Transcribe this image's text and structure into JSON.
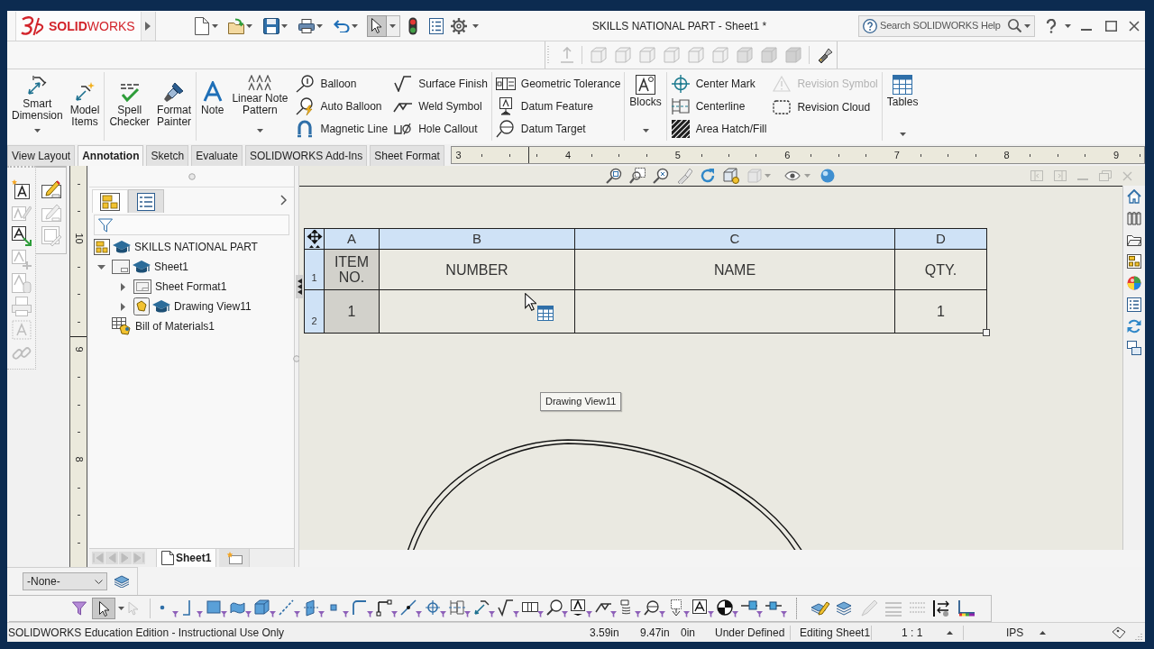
{
  "window": {
    "logo": "**SOLID**WORKS",
    "title": "SKILLS NATIONAL PART - Sheet1 *"
  },
  "quick_access": {
    "pointer_pressed": true
  },
  "search": {
    "placeholder": "Search SOLIDWORKS Help"
  },
  "ribbon": {
    "groups": [
      {
        "items": [
          {
            "kind": "large",
            "label": "Smart Dimension",
            "menu": true
          },
          {
            "kind": "large",
            "label": "Model Items",
            "menu": false
          }
        ]
      },
      {
        "items": [
          {
            "kind": "large",
            "label": "Spell Checker",
            "menu": false
          },
          {
            "kind": "large",
            "label": "Format Painter",
            "menu": false
          }
        ]
      },
      {
        "items": [
          {
            "kind": "large",
            "label": "Note",
            "menu": false
          },
          {
            "kind": "large",
            "label": "Linear Note Pattern",
            "menu": true
          },
          {
            "kind": "stack",
            "entries": [
              {
                "label": "Balloon",
                "disabled": false
              },
              {
                "label": "Auto Balloon",
                "disabled": false
              },
              {
                "label": "Magnetic Line",
                "disabled": false
              }
            ]
          },
          {
            "kind": "stack",
            "entries": [
              {
                "label": "Surface Finish",
                "disabled": false
              },
              {
                "label": "Weld Symbol",
                "disabled": false
              },
              {
                "label": "Hole Callout",
                "disabled": false
              }
            ]
          }
        ]
      },
      {
        "items": [
          {
            "kind": "stack",
            "entries": [
              {
                "label": "Geometric Tolerance",
                "disabled": false
              },
              {
                "label": "Datum Feature",
                "disabled": false
              },
              {
                "label": "Datum Target",
                "disabled": false
              }
            ]
          }
        ]
      },
      {
        "items": [
          {
            "kind": "large",
            "label": "Blocks",
            "menu": true
          }
        ]
      },
      {
        "items": [
          {
            "kind": "stack",
            "entries": [
              {
                "label": "Center Mark",
                "disabled": false
              },
              {
                "label": "Centerline",
                "disabled": false
              },
              {
                "label": "Area Hatch/Fill",
                "disabled": false
              }
            ]
          },
          {
            "kind": "stack",
            "entries": [
              {
                "label": "Revision Symbol",
                "disabled": true
              },
              {
                "label": "Revision Cloud",
                "disabled": false
              }
            ]
          }
        ]
      },
      {
        "items": [
          {
            "kind": "large",
            "label": "Tables",
            "menu": true
          }
        ]
      }
    ]
  },
  "tabs": [
    {
      "label": "View Layout",
      "selected": false
    },
    {
      "label": "Annotation",
      "selected": true
    },
    {
      "label": "Sketch",
      "selected": false
    },
    {
      "label": "Evaluate",
      "selected": false
    },
    {
      "label": "SOLIDWORKS Add-Ins",
      "selected": false
    },
    {
      "label": "Sheet Format",
      "selected": false
    }
  ],
  "top_ruler": {
    "labels": [
      "3",
      "4",
      "5",
      "6",
      "7",
      "8",
      "9"
    ]
  },
  "side_ruler": {
    "labels": [
      "10",
      "9",
      "8"
    ]
  },
  "feature_manager": {
    "tabs": [
      {
        "selected": true
      },
      {
        "selected": false
      }
    ],
    "tree": [
      {
        "label": "SKILLS NATIONAL PART",
        "kind": "drawing",
        "children": [
          {
            "label": "Sheet1",
            "kind": "sheet",
            "expanded": true,
            "children": [
              {
                "label": "Sheet Format1",
                "kind": "sheet_format",
                "expanded": false
              },
              {
                "label": "Drawing View11",
                "kind": "view",
                "expanded": false
              }
            ]
          },
          {
            "label": "Bill of Materials1",
            "kind": "bom"
          }
        ]
      }
    ],
    "sheet_tab": "Sheet1"
  },
  "bom_table": {
    "columns": [
      {
        "letter": "A",
        "locked": true
      },
      {
        "letter": "B",
        "locked": false
      },
      {
        "letter": "C",
        "locked": false
      },
      {
        "letter": "D",
        "locked": false
      }
    ],
    "rows": [
      {
        "number": "1",
        "cells": [
          "ITEM NO.",
          "NUMBER",
          "NAME",
          "QTY."
        ]
      },
      {
        "number": "2",
        "cells": [
          "1",
          null,
          null,
          "1"
        ]
      }
    ]
  },
  "tooltip": "Drawing View11",
  "layer": {
    "value": "-None-"
  },
  "selection_filter": {
    "pointer_pressed": true
  },
  "status_bar": {
    "message": "SOLIDWORKS Education Edition - Instructional Use Only",
    "readouts": [
      "3.59in",
      "9.47in",
      "0in"
    ],
    "state": "Under Defined",
    "mode": "Editing Sheet1",
    "scale": "1 : 1",
    "units": "IPS"
  }
}
